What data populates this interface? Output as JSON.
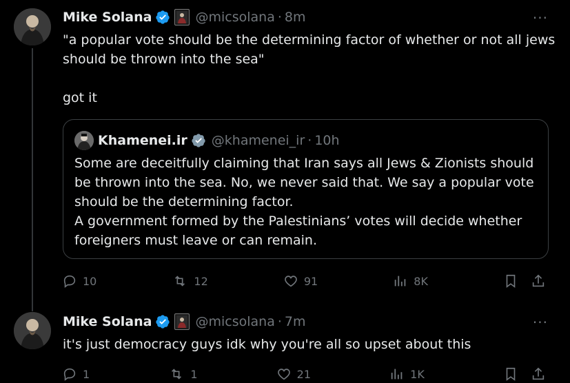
{
  "tweet1": {
    "author_name": "Mike Solana",
    "handle": "@micsolana",
    "time": "8m",
    "text_line1": "\"a popular vote should be the determining factor of whether or not all jews",
    "text_line2": "should be thrown into the sea\"",
    "text_line3": "got it",
    "more": "···",
    "quote": {
      "author_name": "Khamenei.ir",
      "handle": "@khamenei_ir",
      "time": "10h",
      "lines": [
        "Some are deceitfully claiming that Iran says all Jews & Zionists should",
        "be thrown into the sea. No, we never said that. We say a popular vote",
        "should be the determining factor.",
        "A government formed by the Palestinians’ votes will decide whether",
        "foreigners must leave or can remain."
      ]
    },
    "actions": {
      "replies": "10",
      "reposts": "12",
      "likes": "91",
      "views": "8K"
    }
  },
  "tweet2": {
    "author_name": "Mike Solana",
    "handle": "@micsolana",
    "time": "7m",
    "text": "it's just democracy guys idk why you're all so upset about this",
    "more": "···",
    "actions": {
      "replies": "1",
      "reposts": "1",
      "likes": "21",
      "views": "1K"
    }
  },
  "colors": {
    "background": "#000000",
    "text": "#e7e9ea",
    "secondary": "#71767b",
    "verified": "#1d9bf0",
    "border": "#2f3336"
  },
  "sep": "·"
}
